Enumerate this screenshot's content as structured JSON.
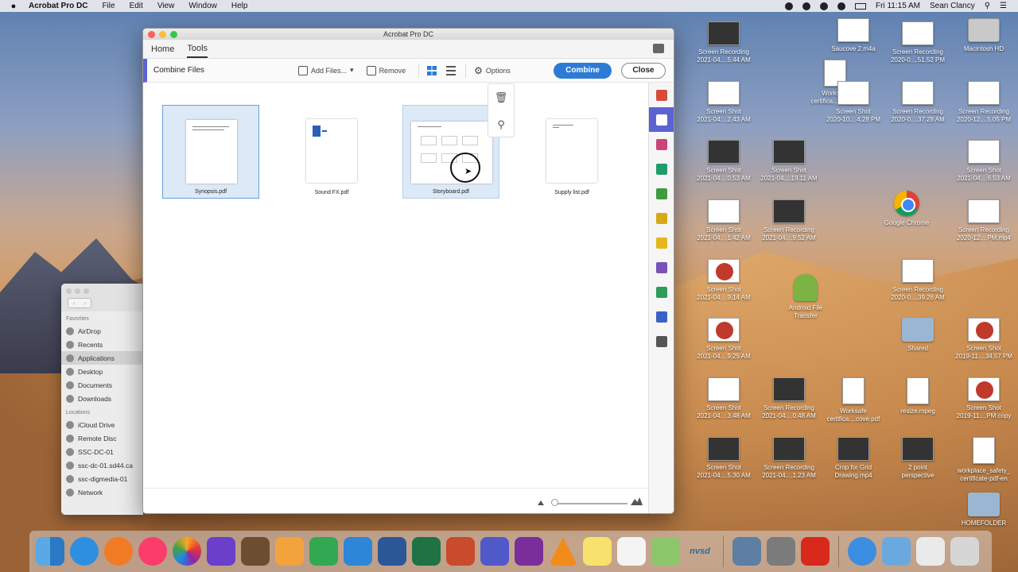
{
  "menubar": {
    "app": "Acrobat Pro DC",
    "items": [
      "File",
      "Edit",
      "View",
      "Window",
      "Help"
    ],
    "clock": "Fri 11:15 AM",
    "user": "Sean Clancy"
  },
  "window": {
    "title": "Acrobat Pro DC",
    "tabs": [
      "Home",
      "Tools"
    ],
    "toolbar": {
      "title": "Combine Files",
      "add_files": "Add Files...",
      "remove": "Remove",
      "options": "Options",
      "combine": "Combine",
      "close": "Close"
    },
    "files": [
      "Synopsis.pdf",
      "Sound FX.pdf",
      "Storyboard.pdf",
      "Supply list.pdf"
    ]
  },
  "finder": {
    "favorites_label": "Favorites",
    "favorites": [
      "AirDrop",
      "Recents",
      "Applications",
      "Desktop",
      "Documents",
      "Downloads"
    ],
    "locations_label": "Locations",
    "locations": [
      "iCloud Drive",
      "Remote Disc",
      "SSC-DC-01",
      "ssc-dc-01.sd44.ca",
      "ssc-digmedia-01",
      "Network"
    ]
  },
  "desktop": {
    "icons": [
      {
        "l1": "Screen Recording",
        "l2": "2021-04....5.44 AM",
        "type": "dark"
      },
      {
        "l1": "Screen Shot",
        "l2": "2021-04....2.43 AM",
        "type": "red-car"
      },
      {
        "l1": "Screen Shot",
        "l2": "2021-04....0.53 AM",
        "type": "dark"
      },
      {
        "l1": "Screen Shot",
        "l2": "2021-04....1.42 AM",
        "type": "plain"
      },
      {
        "l1": "Screen Shot",
        "l2": "2021-04....9.14 AM",
        "type": "red"
      },
      {
        "l1": "Screen Shot",
        "l2": "2021-04....9.25 AM",
        "type": "red"
      },
      {
        "l1": "Screen Shot",
        "l2": "2021-04....3.48 AM",
        "type": "plain"
      },
      {
        "l1": "Screen Shot",
        "l2": "2021-04....5.30 AM",
        "type": "dark"
      },
      {
        "l1": "Screen Shot",
        "l2": "2021-04....19.11 AM",
        "type": "dark"
      },
      {
        "l1": "Screen Recording",
        "l2": "2021-04....9.52 AM",
        "type": "dark"
      },
      {
        "l1": "Android File",
        "l2": "Transfer",
        "type": "android"
      },
      {
        "l1": "Screen Recording",
        "l2": "2021-04....0.48 AM",
        "type": "dark"
      },
      {
        "l1": "Screen Recording",
        "l2": "2021-04....1.23 AM",
        "type": "dark"
      },
      {
        "l1": "Saucove 2.m4a",
        "l2": "",
        "type": "plain"
      },
      {
        "l1": "Worksafe",
        "l2": "certifica...Yeo.pdf",
        "type": "doc"
      },
      {
        "l1": "Screen Shot",
        "l2": "2020-10....4.28 PM",
        "type": "plain"
      },
      {
        "l1": "Google Chrome",
        "l2": "",
        "type": "chrome"
      },
      {
        "l1": "Worksafe",
        "l2": "certifica....cove.pdf",
        "type": "doc"
      },
      {
        "l1": "Crop for Grid",
        "l2": "Drawing.mp4",
        "type": "dark"
      },
      {
        "l1": "Screen Recording",
        "l2": "2020-0....51.52 PM",
        "type": "plain"
      },
      {
        "l1": "Screen Recording",
        "l2": "2020-0....37.28 AM",
        "type": "plain"
      },
      {
        "l1": "Screen Recording",
        "l2": "2020-0....39.26 AM",
        "type": "plain"
      },
      {
        "l1": "Shared",
        "l2": "",
        "type": "folder"
      },
      {
        "l1": "resize.mpeg",
        "l2": "",
        "type": "doc"
      },
      {
        "l1": "2 point",
        "l2": "perspective",
        "type": "dark"
      },
      {
        "l1": "Macintosh HD",
        "l2": "",
        "type": "hd"
      },
      {
        "l1": "Screen Recording",
        "l2": "2020-12....5.05 PM",
        "type": "plain"
      },
      {
        "l1": "Screen Shot",
        "l2": "2021-04....6.53 AM",
        "type": "plain"
      },
      {
        "l1": "Screen Recording",
        "l2": "2020-12....PM.mp4",
        "type": "plain"
      },
      {
        "l1": "Screen Shot",
        "l2": "2019-11....34.57 PM",
        "type": "red"
      },
      {
        "l1": "Screen Shot",
        "l2": "2019-11....PM copy",
        "type": "red"
      },
      {
        "l1": "workplace_safety_",
        "l2": "certificate-pdf-en",
        "type": "doc"
      },
      {
        "l1": "HOMEFOLDER",
        "l2": "",
        "type": "folder"
      }
    ]
  }
}
